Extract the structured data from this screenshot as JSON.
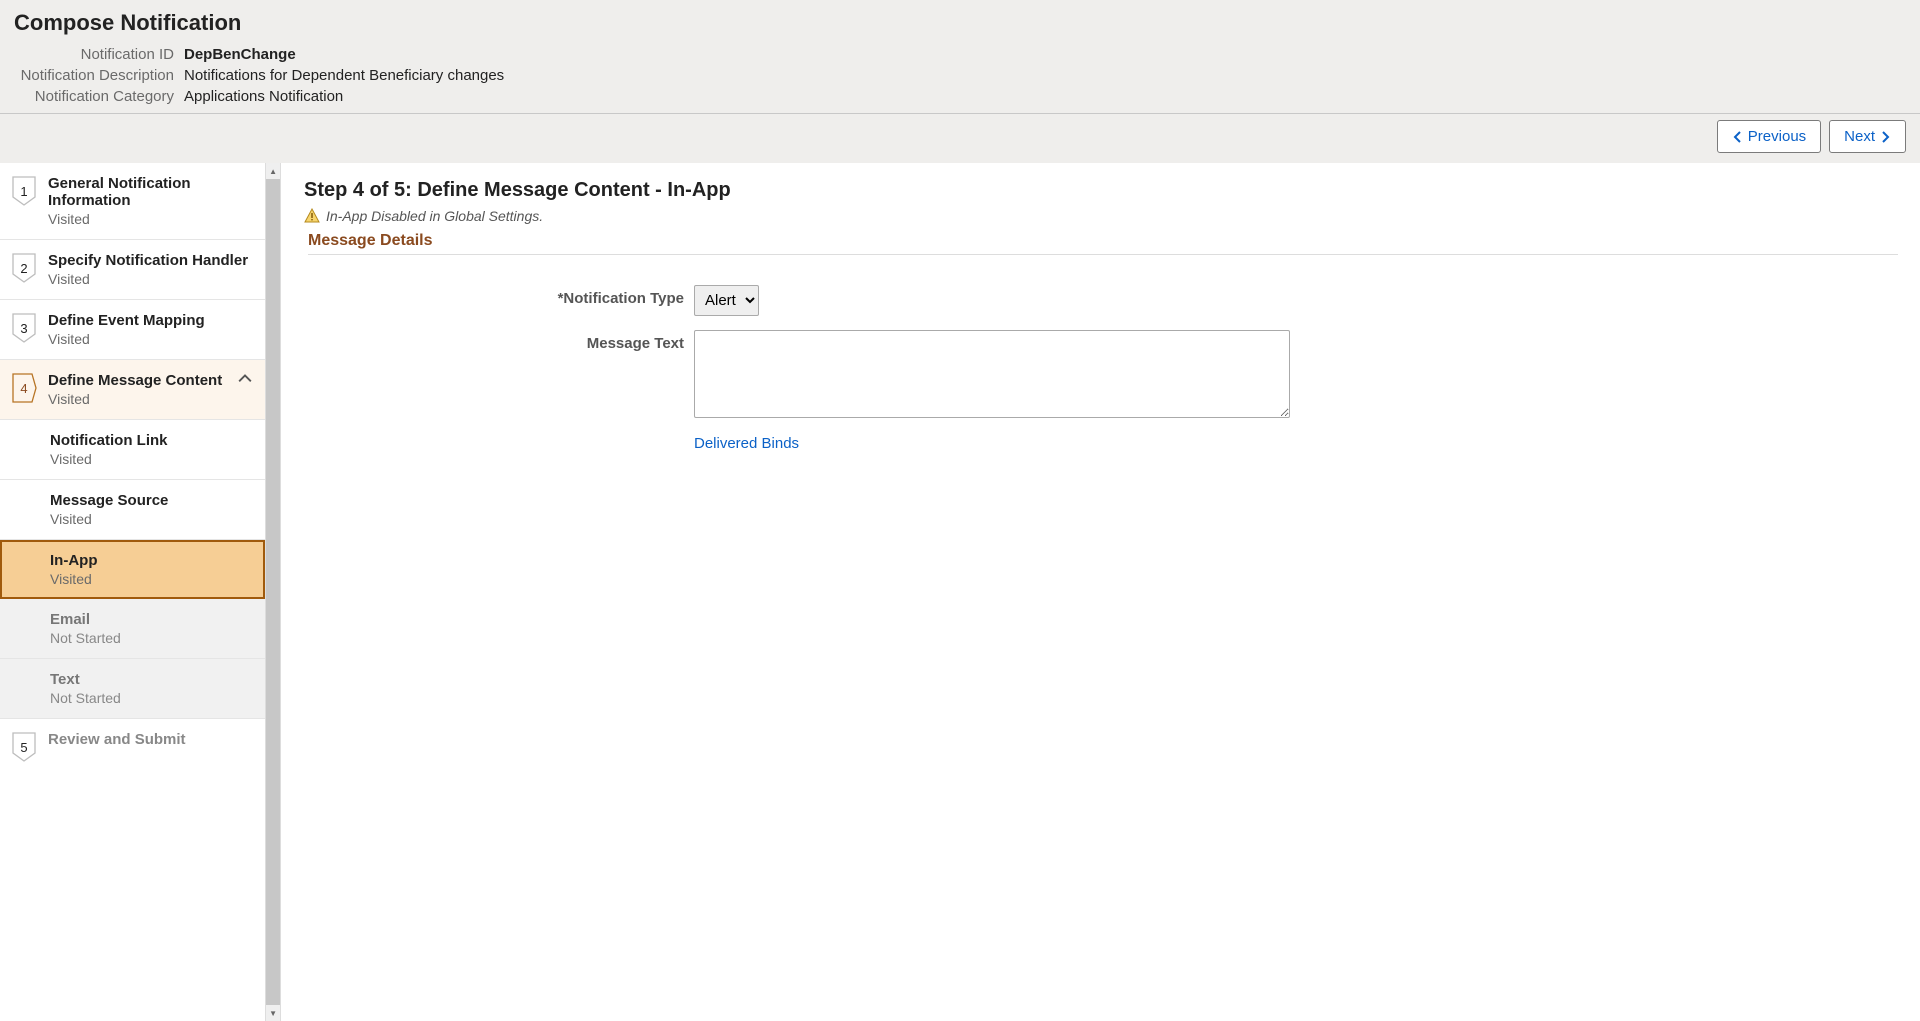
{
  "header": {
    "title": "Compose Notification",
    "meta": {
      "id_label": "Notification ID",
      "id_value": "DepBenChange",
      "desc_label": "Notification Description",
      "desc_value": "Notifications for Dependent Beneficiary changes",
      "cat_label": "Notification Category",
      "cat_value": "Applications Notification"
    },
    "prev_label": "Previous",
    "next_label": "Next"
  },
  "sidebar": {
    "steps": [
      {
        "num": "1",
        "title": "General Notification Information",
        "status": "Visited"
      },
      {
        "num": "2",
        "title": "Specify Notification Handler",
        "status": "Visited"
      },
      {
        "num": "3",
        "title": "Define Event Mapping",
        "status": "Visited"
      },
      {
        "num": "4",
        "title": "Define Message Content",
        "status": "Visited"
      },
      {
        "num": "5",
        "title": "Review and Submit",
        "status": ""
      }
    ],
    "substeps": [
      {
        "title": "Notification Link",
        "status": "Visited"
      },
      {
        "title": "Message Source",
        "status": "Visited"
      },
      {
        "title": "In-App",
        "status": "Visited"
      },
      {
        "title": "Email",
        "status": "Not Started"
      },
      {
        "title": "Text",
        "status": "Not Started"
      }
    ]
  },
  "content": {
    "heading": "Step 4 of 5: Define Message Content - In-App",
    "warning": "In-App Disabled in Global Settings.",
    "section": "Message Details",
    "notif_type_label": "*Notification Type",
    "notif_type_value": "Alert",
    "msg_text_label": "Message Text",
    "msg_text_value": "",
    "delivered_binds": "Delivered Binds"
  }
}
